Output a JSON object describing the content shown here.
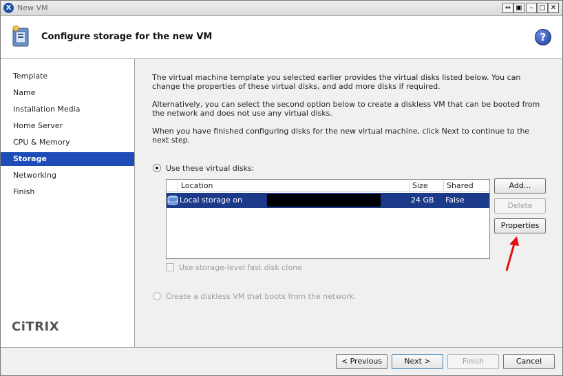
{
  "window": {
    "title": "New VM",
    "controls": {
      "restore_label": "⇔",
      "pin_label": "▣",
      "minimize_label": "–",
      "maximize_label": "□",
      "close_label": "✕"
    }
  },
  "header": {
    "title": "Configure storage for the new VM",
    "help_label": "?"
  },
  "sidebar": {
    "items": [
      {
        "label": "Template"
      },
      {
        "label": "Name"
      },
      {
        "label": "Installation Media"
      },
      {
        "label": "Home Server"
      },
      {
        "label": "CPU & Memory"
      },
      {
        "label": "Storage"
      },
      {
        "label": "Networking"
      },
      {
        "label": "Finish"
      }
    ],
    "active_index": 5,
    "logo_text": "CiTRIX"
  },
  "content": {
    "para1": "The virtual machine template you selected earlier provides the virtual disks listed below. You can change the properties of these virtual disks, and add more disks if required.",
    "para2": "Alternatively, you can select the second option below to create a diskless VM that can be booted from the network and does not use any virtual disks.",
    "para3": "When you have finished configuring disks for the new virtual machine, click Next to continue to the next step.",
    "option_use_disks": "Use these virtual disks:",
    "option_diskless": "Create a diskless VM that boots from the network.",
    "fast_clone_label": "Use storage-level fast disk clone",
    "disk_table": {
      "columns": [
        "Location",
        "Size",
        "Shared"
      ],
      "rows": [
        {
          "location": "Local storage on",
          "size": "24 GB",
          "shared": "False"
        }
      ]
    },
    "buttons": {
      "add": "Add...",
      "delete": "Delete",
      "properties": "Properties"
    }
  },
  "footer": {
    "previous": "< Previous",
    "next": "Next >",
    "finish": "Finish",
    "cancel": "Cancel"
  },
  "colors": {
    "selection": "#1e4db7",
    "annotation_arrow": "#e01010"
  }
}
